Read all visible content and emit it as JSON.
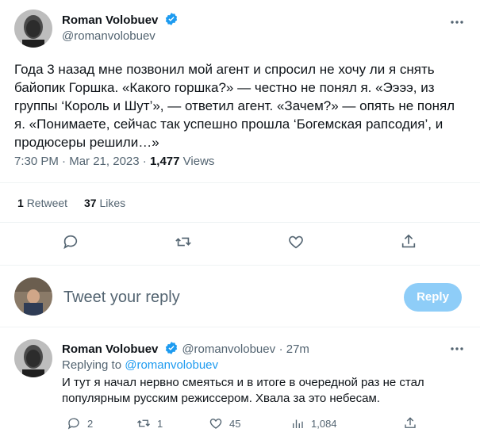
{
  "main_tweet": {
    "author_name": "Roman Volobuev",
    "author_handle": "@romanvolobuev",
    "text": "Года 3 назад мне позвонил мой агент и спросил не хочу ли я снять байопик Горшка. «Какого горшка?» — честно не понял я. «Ээээ, из группы ‘Король и Шут’», — ответил агент. «Зачем?» — опять не понял я. «Понимаете, сейчас так успешно прошла ‘Богемская рапсодия’, и продюсеры решили…»",
    "time": "7:30 PM",
    "date": "Mar 21, 2023",
    "views_count": "1,477",
    "views_label": "Views",
    "retweets_count": "1",
    "retweets_label": "Retweet",
    "likes_count": "37",
    "likes_label": "Likes",
    "more_icon": "more-icon"
  },
  "reply_box": {
    "placeholder": "Tweet your reply",
    "button_label": "Reply"
  },
  "reply_tweet": {
    "author_name": "Roman Volobuev",
    "author_handle": "@romanvolobuev",
    "time_ago": "27m",
    "replying_prefix": "Replying to",
    "replying_handle": "@romanvolobuev",
    "text": "И тут я начал нервно смеяться и в итоге в очередной раз не стал популярным русским режиссером. Хвала за это небесам.",
    "replies": "2",
    "retweets": "1",
    "likes": "45",
    "views": "1,084"
  },
  "colors": {
    "accent": "#1d9bf0",
    "reply_button_disabled": "#8ecdf8",
    "secondary_text": "#536471"
  }
}
